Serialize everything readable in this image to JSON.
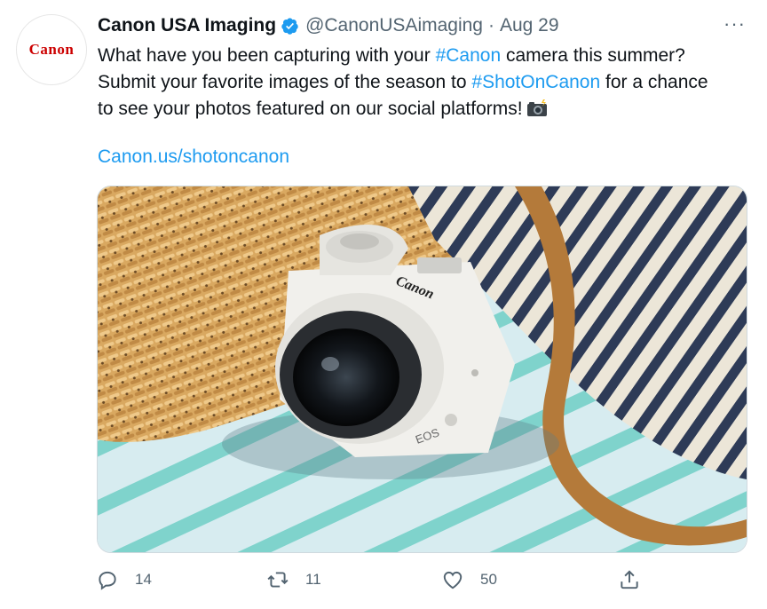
{
  "author": {
    "avatar_text": "Canon",
    "name": "Canon USA Imaging",
    "handle": "@CanonUSAimaging",
    "separator": "·",
    "date": "Aug 29"
  },
  "more_label": "···",
  "tweet": {
    "line1_pre": "What have you been capturing with your ",
    "hashtag1": "#Canon",
    "line1_post": " camera this summer?",
    "line2_pre": "Submit your favorite images of the season to ",
    "hashtag2": "#ShotOnCanon",
    "line2_post": " for a chance",
    "line3": "to see your photos featured on our social platforms!",
    "link": "Canon.us/shotoncanon"
  },
  "media": {
    "camera_brand": "Canon",
    "camera_model": "EOS"
  },
  "actions": {
    "replies": "14",
    "retweets": "11",
    "likes": "50"
  },
  "colors": {
    "accent": "#1d9bf0",
    "brand_red": "#cc0000",
    "secondary_text": "#536471"
  }
}
